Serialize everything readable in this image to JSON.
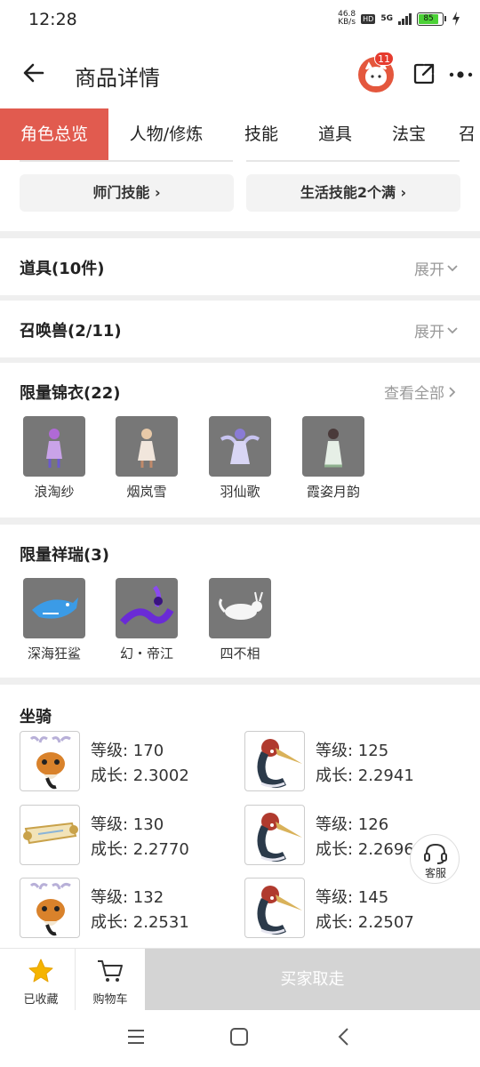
{
  "status": {
    "time": "12:28",
    "net_speed_value": "46.8",
    "net_speed_unit": "KB/s",
    "hd": "HD",
    "network": "5G",
    "battery": "85"
  },
  "header": {
    "title": "商品详情",
    "notification_count": "11"
  },
  "tabs": [
    {
      "label": "角色总览",
      "active": true
    },
    {
      "label": "人物/修炼"
    },
    {
      "label": "技能"
    },
    {
      "label": "道具"
    },
    {
      "label": "法宝"
    },
    {
      "label": "召"
    }
  ],
  "skills": {
    "school_skill": "师门技能",
    "life_skill": "生活技能2个满"
  },
  "items_section": {
    "title": "道具(10件)",
    "action": "展开"
  },
  "pets_section": {
    "title": "召唤兽(2/11)",
    "action": "展开"
  },
  "skins_section": {
    "title": "限量锦衣(22)",
    "action": "查看全部",
    "items": [
      {
        "name": "浪淘纱"
      },
      {
        "name": "烟岚雪"
      },
      {
        "name": "羽仙歌"
      },
      {
        "name": "霞姿月韵"
      }
    ]
  },
  "auspice_section": {
    "title": "限量祥瑞(3)",
    "items": [
      {
        "name": "深海狂鲨"
      },
      {
        "name": "幻・帝江"
      },
      {
        "name": "四不相"
      }
    ]
  },
  "mounts_section": {
    "title": "坐骑",
    "level_label": "等级: ",
    "growth_label": "成长: ",
    "items": [
      {
        "level": "170",
        "growth": "2.3002",
        "icon": "deer-icon"
      },
      {
        "level": "125",
        "growth": "2.2941",
        "icon": "crane-icon"
      },
      {
        "level": "130",
        "growth": "2.2770",
        "icon": "scroll-icon"
      },
      {
        "level": "126",
        "growth": "2.2696",
        "icon": "crane-icon"
      },
      {
        "level": "132",
        "growth": "2.2531",
        "icon": "deer-icon"
      },
      {
        "level": "145",
        "growth": "2.2507",
        "icon": "crane-icon"
      }
    ]
  },
  "service": {
    "label": "客服"
  },
  "bottom_bar": {
    "favorite_label": "已收藏",
    "cart_label": "购物车",
    "buy_label": "买家取走"
  },
  "colors": {
    "accent": "#e15b4f",
    "favorite_star": "#f5b400",
    "disabled_button": "#d4d4d4"
  }
}
